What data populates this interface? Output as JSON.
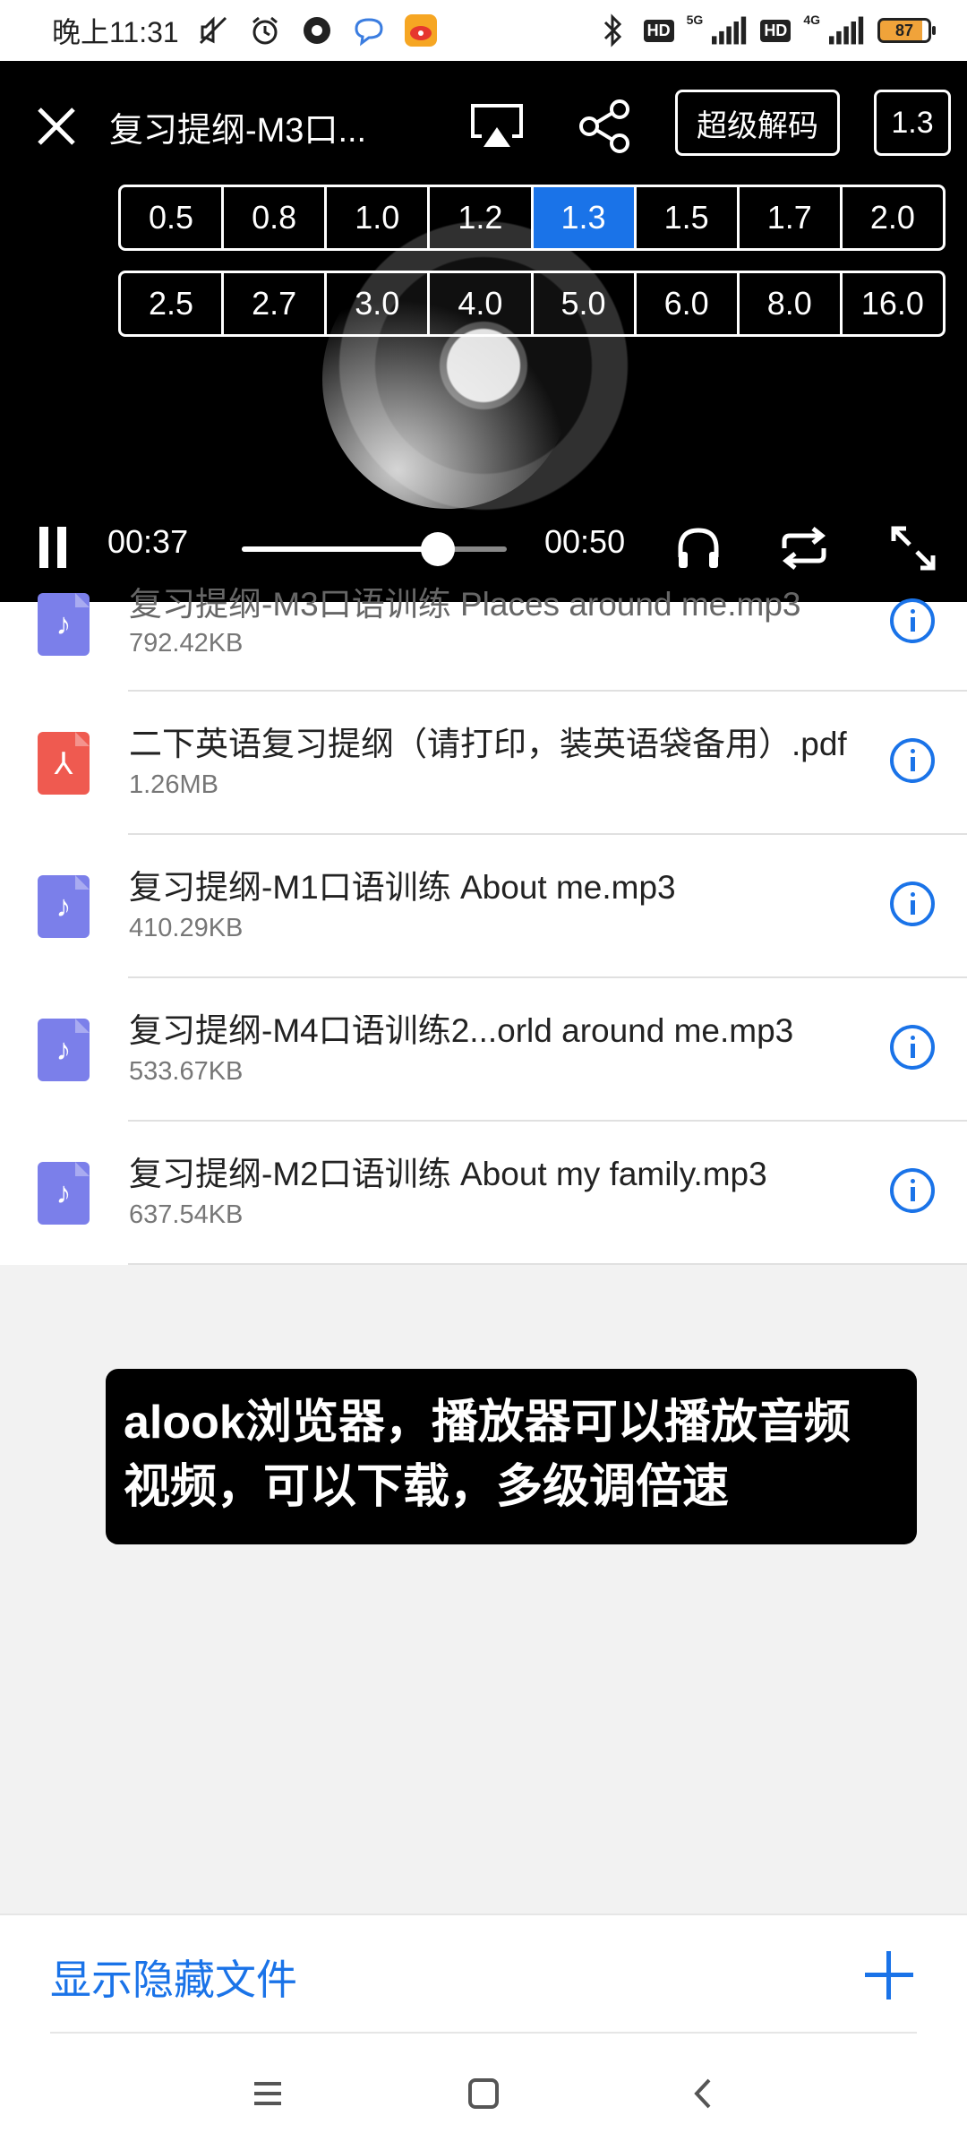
{
  "status": {
    "time": "晚上11:31",
    "net1": "5G",
    "net2": "4G",
    "hd1": "HD",
    "hd2": "HD",
    "battery": "87"
  },
  "player": {
    "title": "复习提纲-M3口...",
    "decode_label": "超级解码",
    "current_speed": "1.3",
    "speeds_row1": [
      "0.5",
      "0.8",
      "1.0",
      "1.2",
      "1.3",
      "1.5",
      "1.7",
      "2.0"
    ],
    "speeds_row2": [
      "2.5",
      "2.7",
      "3.0",
      "4.0",
      "5.0",
      "6.0",
      "8.0",
      "16.0"
    ],
    "time_current": "00:37",
    "time_duration": "00:50",
    "progress": 0.74
  },
  "files": [
    {
      "name": "复习提纲-M3口语训练 Places around me.mp3",
      "size": "792.42KB",
      "type": "audio"
    },
    {
      "name": "二下英语复习提纲（请打印，装英语袋备用）.pdf",
      "size": "1.26MB",
      "type": "pdf"
    },
    {
      "name": "复习提纲-M1口语训练  About me.mp3",
      "size": "410.29KB",
      "type": "audio"
    },
    {
      "name": "复习提纲-M4口语训练2...orld around me.mp3",
      "size": "533.67KB",
      "type": "audio"
    },
    {
      "name": "复习提纲-M2口语训练 About my family.mp3",
      "size": "637.54KB",
      "type": "audio"
    }
  ],
  "caption": {
    "line1": "alook浏览器，播放器可以播放音频",
    "line2": "视频，可以下载，多级调倍速"
  },
  "bottom": {
    "show_hidden": "显示隐藏文件"
  },
  "colors": {
    "accent": "#1a73e8",
    "audio_icon": "#7b7fea",
    "pdf_icon": "#ef5a50"
  }
}
